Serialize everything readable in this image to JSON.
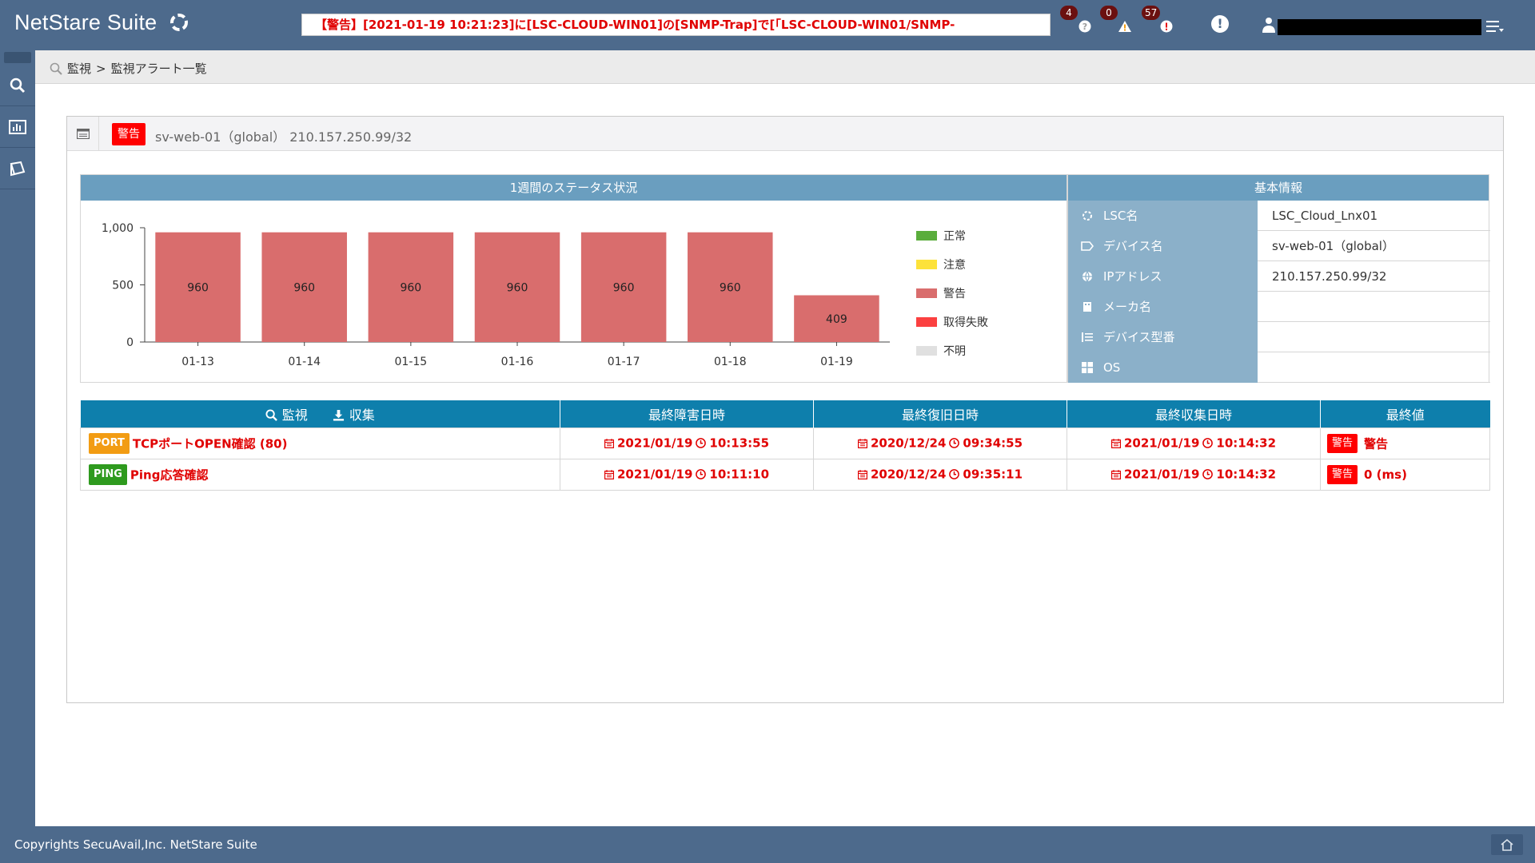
{
  "header": {
    "app_title": "NetStare Suite",
    "ticker_text": "【警告】[2021-01-19 10:21:23]に[LSC-CLOUD-WIN01]の[SNMP-Trap]で[「LSC-CLOUD-WIN01/SNMP-",
    "notifications": [
      {
        "name": "unknown",
        "count": "4",
        "color": "#9e9e9e",
        "icon": "question-icon"
      },
      {
        "name": "caution",
        "count": "0",
        "color": "#f29c13",
        "icon": "warning-triangle-icon"
      },
      {
        "name": "alert",
        "count": "57",
        "color": "#e8000b",
        "icon": "exclamation-icon"
      }
    ]
  },
  "breadcrumb": {
    "root": "監視",
    "sep": ">",
    "current": "監視アラート一覧"
  },
  "panel": {
    "status_label": "警告",
    "device_title": "sv-web-01（global） 210.157.250.99/32"
  },
  "chart_data": {
    "type": "bar",
    "title": "1週間のステータス状況",
    "categories": [
      "01-13",
      "01-14",
      "01-15",
      "01-16",
      "01-17",
      "01-18",
      "01-19"
    ],
    "series": [
      {
        "name": "正常",
        "color": "#5aad3c",
        "values": [
          0,
          0,
          0,
          0,
          0,
          0,
          0
        ]
      },
      {
        "name": "注意",
        "color": "#fde23a",
        "values": [
          0,
          0,
          0,
          0,
          0,
          0,
          0
        ]
      },
      {
        "name": "警告",
        "color": "#d96d6d",
        "values": [
          960,
          960,
          960,
          960,
          960,
          960,
          409
        ]
      },
      {
        "name": "取得失敗",
        "color": "#fb4040",
        "values": [
          0,
          0,
          0,
          0,
          0,
          0,
          0
        ]
      },
      {
        "name": "不明",
        "color": "#e0e0e0",
        "values": [
          0,
          0,
          0,
          0,
          0,
          0,
          0
        ]
      }
    ],
    "y_ticks": [
      "0",
      "500",
      "1,000"
    ],
    "ylim": [
      0,
      1000
    ],
    "legend_position": "right",
    "stacked": true
  },
  "basic_info": {
    "title": "基本情報",
    "rows": [
      {
        "key": "LSC名",
        "value": "LSC_Cloud_Lnx01",
        "icon": "gear-icon"
      },
      {
        "key": "デバイス名",
        "value": "sv-web-01（global）",
        "icon": "tag-icon"
      },
      {
        "key": "IPアドレス",
        "value": "210.157.250.99/32",
        "icon": "globe-icon"
      },
      {
        "key": "メーカ名",
        "value": "",
        "icon": "building-icon"
      },
      {
        "key": "デバイス型番",
        "value": "",
        "icon": "list-icon"
      },
      {
        "key": "OS",
        "value": "",
        "icon": "windows-icon"
      }
    ]
  },
  "monitor_table": {
    "head_monitor": "監視",
    "head_collect": "収集",
    "columns": [
      "最終障害日時",
      "最終復旧日時",
      "最終収集日時",
      "最終値"
    ],
    "rows": [
      {
        "type": "PORT",
        "type_color": "#f29c13",
        "name": "TCPポートOPEN確認 (80)",
        "fail_date": "2021/01/19",
        "fail_time": "10:13:55",
        "recover_date": "2020/12/24",
        "recover_time": "09:34:55",
        "collect_date": "2021/01/19",
        "collect_time": "10:14:32",
        "last_tag": "警告",
        "last_value": "警告"
      },
      {
        "type": "PING",
        "type_color": "#2e9a1e",
        "name": "Ping応答確認",
        "fail_date": "2021/01/19",
        "fail_time": "10:11:10",
        "recover_date": "2020/12/24",
        "recover_time": "09:35:11",
        "collect_date": "2021/01/19",
        "collect_time": "10:14:32",
        "last_tag": "警告",
        "last_value": "0 (ms)"
      }
    ]
  },
  "footer": {
    "copyright": "Copyrights SecuAvail,Inc.  NetStare Suite"
  }
}
